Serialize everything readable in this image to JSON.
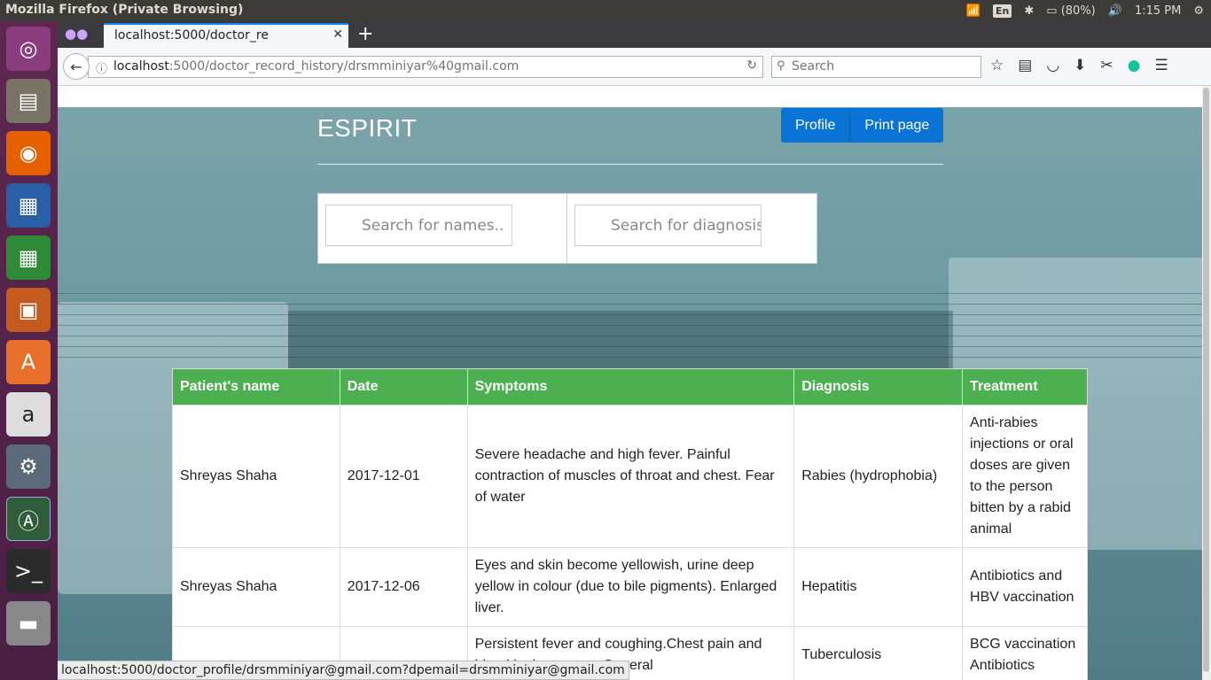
{
  "os": {
    "window_title": "Mozilla Firefox (Private Browsing)",
    "keyboard": "En",
    "battery": "(80%)",
    "clock": "1:15 PM"
  },
  "browser": {
    "tab_title": "localhost:5000/doctor_re",
    "url_host": "localhost",
    "url_rest": ":5000/doctor_record_history/drsmminiyar%40gmail.com",
    "search_placeholder": "Search",
    "status_url": "localhost:5000/doctor_profile/drsmminiyar@gmail.com?dpemail=drsmminiyar@gmail.com"
  },
  "page": {
    "brand": "ESPIRIT",
    "profile_label": "Profile",
    "print_label": "Print page",
    "search_names_placeholder": "Search for names..",
    "search_diagnosis_placeholder": "Search for diagnosis.."
  },
  "table": {
    "headers": [
      "Patient's name",
      "Date",
      "Symptoms",
      "Diagnosis",
      "Treatment"
    ],
    "rows": [
      [
        "Shreyas Shaha",
        "2017-12-01",
        "Severe headache and high fever. Painful contraction of muscles of throat and chest. Fear of water",
        "Rabies (hydrophobia)",
        "Anti-rabies injections or oral doses are given to the person bitten by a rabid animal"
      ],
      [
        "Shreyas Shaha",
        "2017-12-06",
        "Eyes and skin become yellowish, urine deep yellow in colour (due to bile pigments). Enlarged liver.",
        "Hepatitis",
        "Antibiotics and HBV vaccination"
      ],
      [
        "",
        "",
        "Persistent fever and coughing.Chest pain and blood in the sputum.General",
        "Tuberculosis",
        "BCG vaccination Antibiotics"
      ]
    ]
  }
}
